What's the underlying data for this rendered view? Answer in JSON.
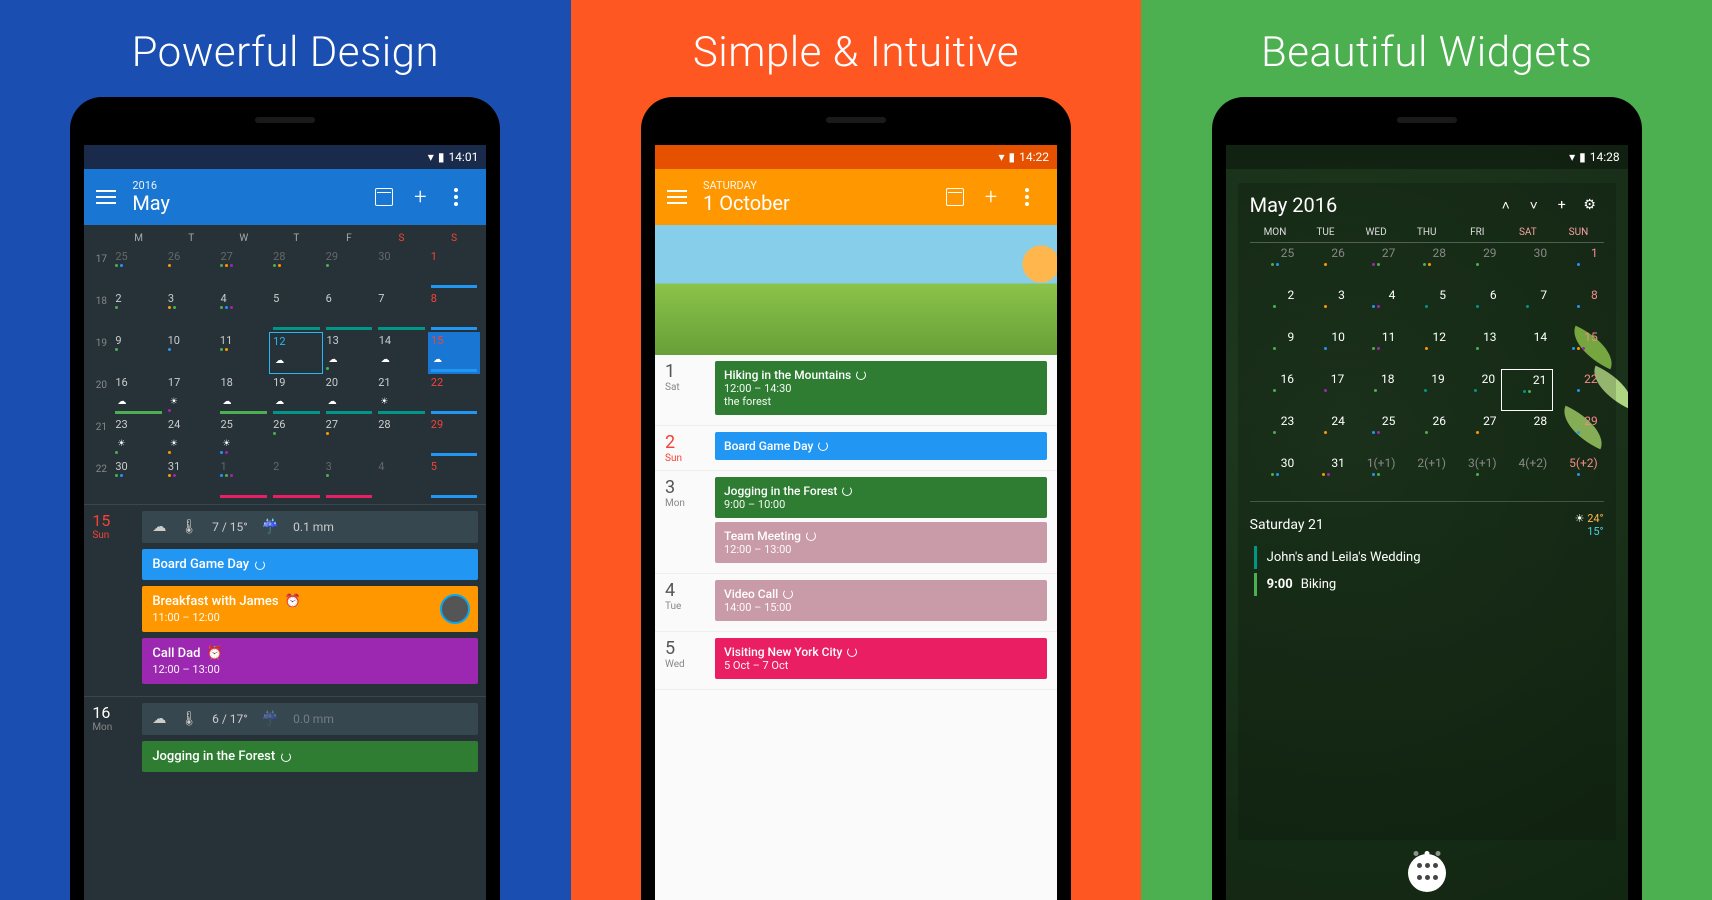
{
  "panels": {
    "p1": {
      "title": "Powerful Design"
    },
    "p2": {
      "title": "Simple & Intuitive"
    },
    "p3": {
      "title": "Beautiful Widgets"
    }
  },
  "status": {
    "time1": "14:01",
    "time2": "14:22",
    "time3": "14:28"
  },
  "s1": {
    "year": "2016",
    "month": "May",
    "dow": [
      "M",
      "T",
      "W",
      "T",
      "F",
      "S",
      "S"
    ],
    "wk": [
      "17",
      "18",
      "19",
      "20",
      "21",
      "22"
    ],
    "grid": [
      [
        "25",
        "26",
        "27",
        "28",
        "29",
        "30",
        "1"
      ],
      [
        "2",
        "3",
        "4",
        "5",
        "6",
        "7",
        "8"
      ],
      [
        "9",
        "10",
        "11",
        "12",
        "13",
        "14",
        "15"
      ],
      [
        "16",
        "17",
        "18",
        "19",
        "20",
        "21",
        "22"
      ],
      [
        "23",
        "24",
        "25",
        "26",
        "27",
        "28",
        "29"
      ],
      [
        "30",
        "31",
        "1",
        "2",
        "3",
        "4",
        "5"
      ]
    ],
    "agenda": [
      {
        "day": "15",
        "dow": "Sun",
        "red": true,
        "weather": {
          "temp": "7 / 15°",
          "rain": "0.1 mm"
        },
        "events": [
          {
            "title": "Board Game Day",
            "color": "#2196f3"
          },
          {
            "title": "Breakfast with James",
            "sub": "11:00 – 12:00",
            "color": "#ff9800",
            "alarm": true,
            "avatar": true
          },
          {
            "title": "Call Dad",
            "sub": "12:00 – 13:00",
            "color": "#9c27b0",
            "alarm": true
          }
        ]
      },
      {
        "day": "16",
        "dow": "Mon",
        "weather": {
          "temp": "6 / 17°",
          "rain": "0.0 mm"
        },
        "events": [
          {
            "title": "Jogging in the Forest",
            "color": "#2e7d32"
          }
        ]
      }
    ]
  },
  "s2": {
    "daylabel": "SATURDAY",
    "date": "1 October",
    "rows": [
      {
        "day": "1",
        "dow": "Sat",
        "events": [
          {
            "title": "Hiking in the Mountains",
            "sub": "12:00 – 14:30",
            "sub2": "the forest",
            "color": "#2e7d32"
          }
        ]
      },
      {
        "day": "2",
        "dow": "Sun",
        "red": true,
        "events": [
          {
            "title": "Board Game Day",
            "color": "#2196f3"
          }
        ]
      },
      {
        "day": "3",
        "dow": "Mon",
        "events": [
          {
            "title": "Jogging in the Forest",
            "sub": "9:00 – 10:00",
            "color": "#2e7d32"
          },
          {
            "title": "Team Meeting",
            "sub": "12:00 – 13:00",
            "color": "#c99aa8"
          }
        ]
      },
      {
        "day": "4",
        "dow": "Tue",
        "events": [
          {
            "title": "Video Call",
            "sub": "14:00 – 15:00",
            "color": "#c99aa8"
          }
        ]
      },
      {
        "day": "5",
        "dow": "Wed",
        "events": [
          {
            "title": "Visiting New York City",
            "sub": "5 Oct – 7 Oct",
            "color": "#e91e63"
          }
        ]
      }
    ]
  },
  "s3": {
    "title": "May 2016",
    "dow": [
      "MON",
      "TUE",
      "WED",
      "THU",
      "FRI",
      "SAT",
      "SUN"
    ],
    "grid": [
      [
        "25",
        "26",
        "27",
        "28",
        "29",
        "30",
        "1"
      ],
      [
        "2",
        "3",
        "4",
        "5",
        "6",
        "7",
        "8"
      ],
      [
        "9",
        "10",
        "11",
        "12",
        "13",
        "14",
        "15"
      ],
      [
        "16",
        "17",
        "18",
        "19",
        "20",
        "21",
        "22"
      ],
      [
        "23",
        "24",
        "25",
        "26",
        "27",
        "28",
        "29"
      ],
      [
        "30",
        "31",
        "1(+1)",
        "2(+1)",
        "3(+1)",
        "4(+2)",
        "5(+2)"
      ]
    ],
    "selDay": "Saturday 21",
    "hi": "24°",
    "lo": "15°",
    "events": [
      {
        "title": "John's and Leila's Wedding"
      },
      {
        "time": "9:00",
        "title": "Biking"
      }
    ]
  }
}
